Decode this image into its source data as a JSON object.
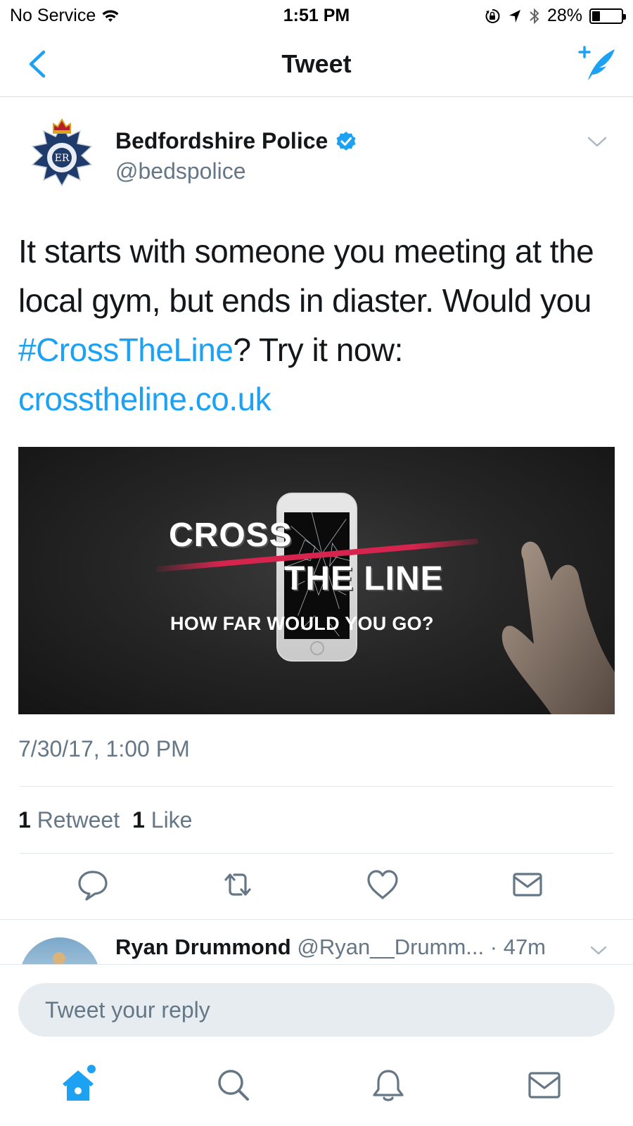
{
  "status_bar": {
    "carrier": "No Service",
    "time": "1:51 PM",
    "battery_percent": "28%",
    "battery_level": 0.28
  },
  "nav": {
    "title": "Tweet"
  },
  "tweet": {
    "author_name": "Bedfordshire Police",
    "author_handle": "@bedspolice",
    "verified": true,
    "text_part1": "It starts with someone you meeting at the local gym, but ends in diaster. Would you ",
    "hashtag": "#CrossTheLine",
    "text_part2": "? Try it now: ",
    "link": "crosstheline.co.uk",
    "avatar_text": "ER",
    "media": {
      "title_line1": "CROSS",
      "title_line2": "THE LINE",
      "tagline": "HOW FAR WOULD YOU GO?"
    },
    "timestamp": "7/30/17, 1:00 PM",
    "retweet_count": "1",
    "retweet_label": "Retweet",
    "like_count": "1",
    "like_label": "Like"
  },
  "reply_preview": {
    "name": "Ryan Drummond",
    "handle": "@Ryan__Drumm...",
    "time": "· 47m"
  },
  "reply_box": {
    "placeholder": "Tweet your reply"
  },
  "colors": {
    "accent": "#1da1f2",
    "text_secondary": "#657786",
    "text_primary": "#14171a"
  },
  "icons": {
    "nav": [
      "back-chevron-icon",
      "compose-tweet-icon"
    ],
    "actions": [
      "reply-icon",
      "retweet-icon",
      "like-icon",
      "direct-message-icon"
    ],
    "tabs": [
      "home-icon",
      "search-icon",
      "notifications-icon",
      "messages-icon"
    ]
  }
}
